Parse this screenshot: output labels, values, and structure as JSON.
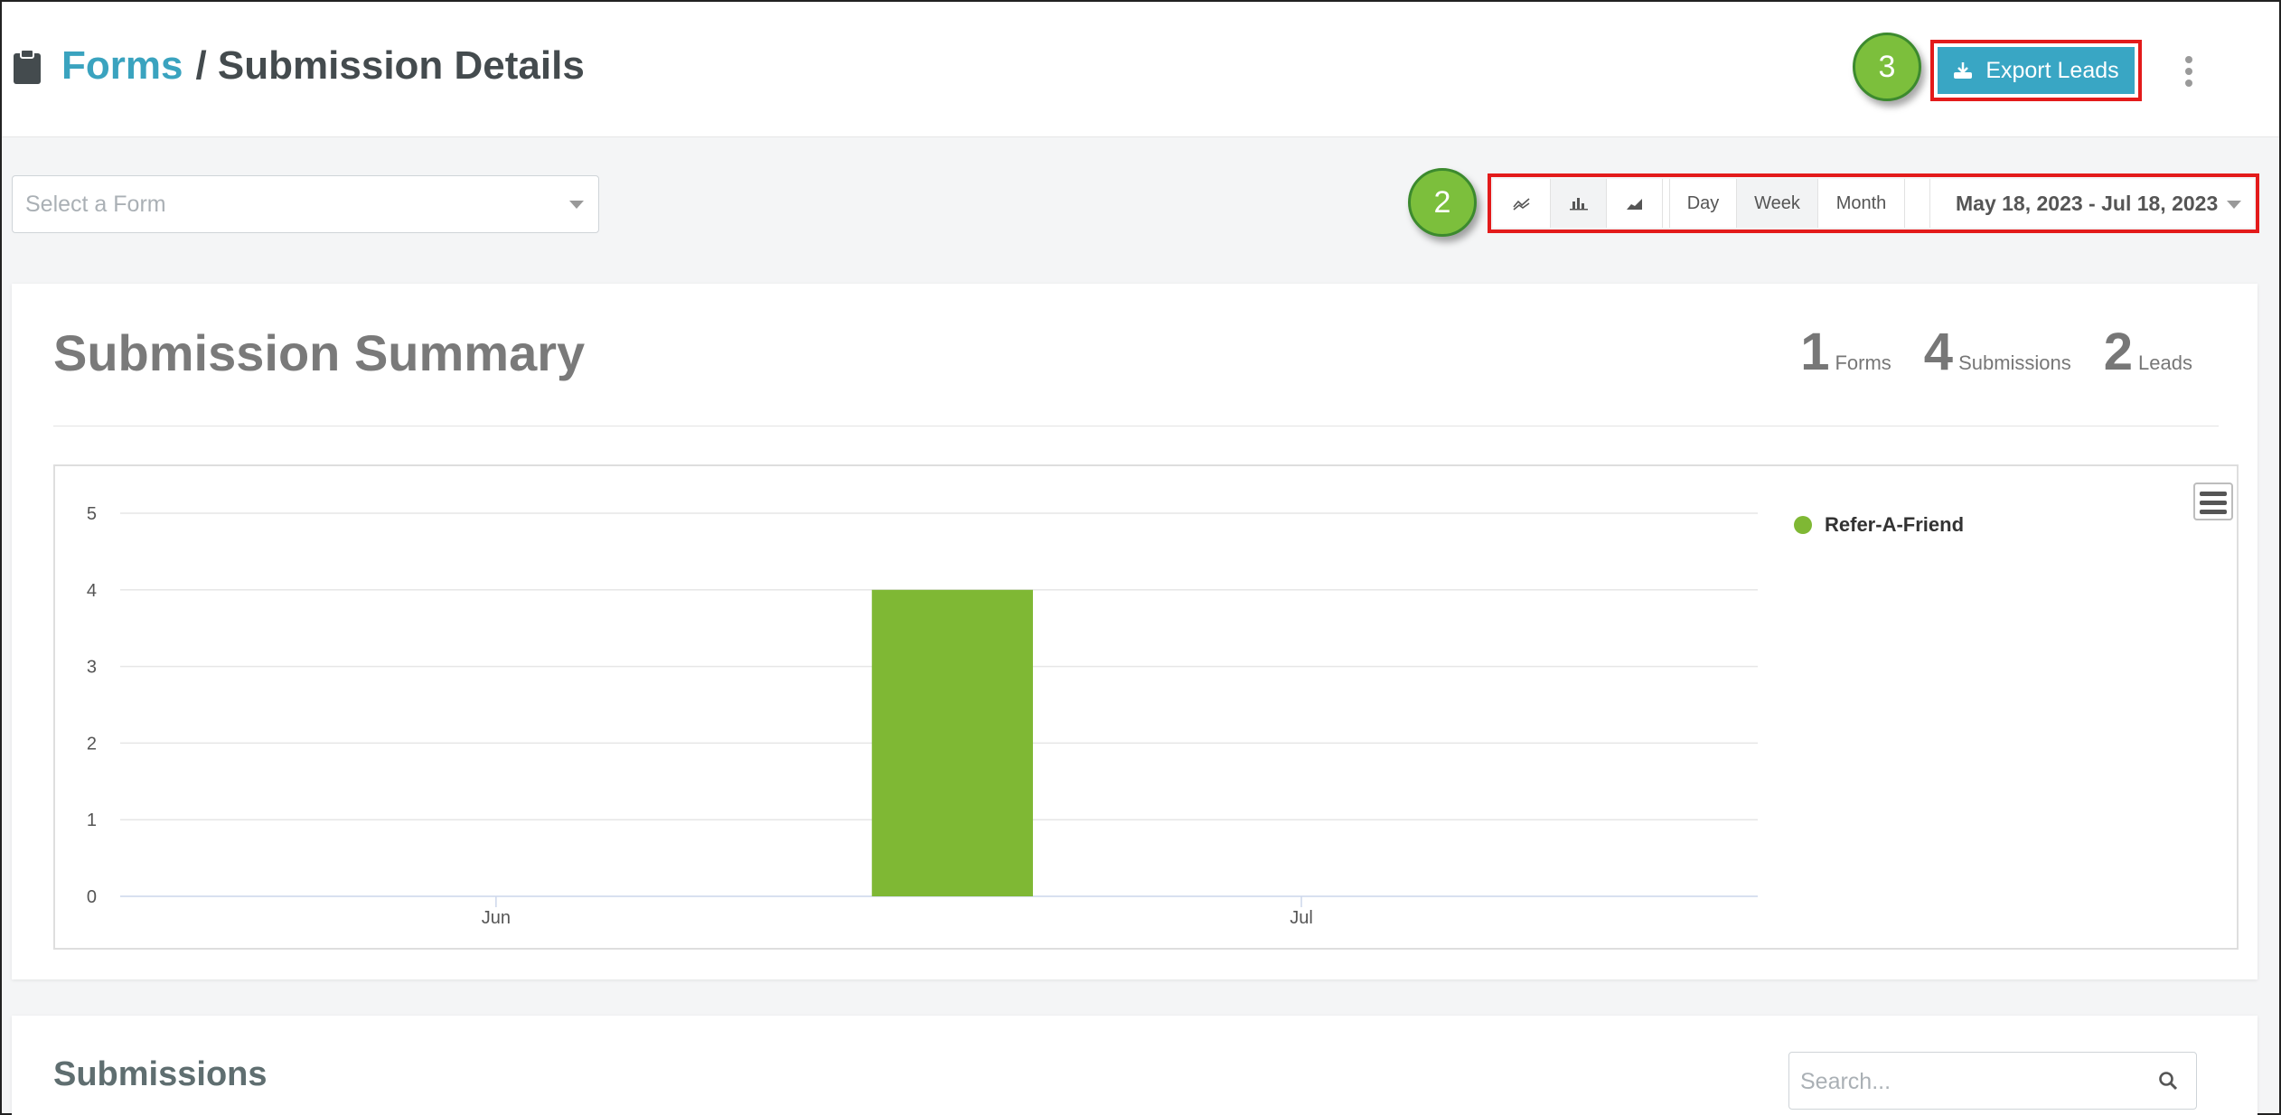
{
  "header": {
    "breadcrumb_link": "Forms",
    "breadcrumb_current": "/ Submission Details",
    "export_label": "Export Leads",
    "badge_export": "3"
  },
  "filters": {
    "select_placeholder": "Select a Form",
    "badge_controls": "2",
    "period_buttons": [
      "Day",
      "Week",
      "Month"
    ],
    "date_range": "May 18, 2023 - Jul 18, 2023"
  },
  "summary": {
    "title": "Submission Summary",
    "stats": [
      {
        "value": "1",
        "label": "Forms"
      },
      {
        "value": "4",
        "label": "Submissions"
      },
      {
        "value": "2",
        "label": "Leads"
      }
    ]
  },
  "chart_data": {
    "type": "bar",
    "x_ticks": [
      "Jun",
      "Jul"
    ],
    "y_ticks": [
      0,
      1,
      2,
      3,
      4,
      5
    ],
    "ylim": [
      0,
      5
    ],
    "series": [
      {
        "name": "Refer-A-Friend",
        "color": "#7fb834",
        "points": [
          {
            "date": "2023-06-18",
            "value": 4
          }
        ]
      }
    ],
    "xlim": [
      "2023-05-18",
      "2023-07-18"
    ],
    "grid": true,
    "legend": "right"
  },
  "submissions": {
    "title": "Submissions",
    "search_placeholder": "Search..."
  },
  "colors": {
    "accent": "#39a6c4",
    "highlight": "#e31b1b",
    "badge": "#7cbf3c",
    "bar": "#7fb834"
  }
}
